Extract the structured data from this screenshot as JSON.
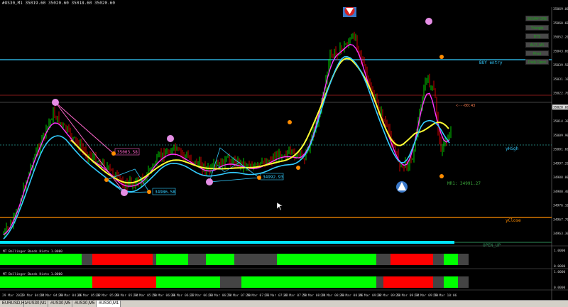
{
  "window": {
    "title": "#US30,M1  35019.60 35020.60 35018.60 35020.60"
  },
  "buttons": [
    "SEMAFORE",
    "Triangle",
    "BTS",
    "AUT_M1",
    "Pivot",
    "Daily Open"
  ],
  "labels": {
    "buy_entry": "BUY entry",
    "yhigh": "yHigh",
    "yclose": "yClose",
    "open_up": "OPEN_UP",
    "timer": "<---00:43",
    "mr": "MR1: 34991.27",
    "level_a": "35003.58",
    "level_b": "34986.58",
    "level_c": "34992.93"
  },
  "price_axis": [
    "35069.00",
    "35060.60",
    "35052.20",
    "35043.80",
    "35039.50",
    "35031.10",
    "35022.70",
    "35020.60",
    "35014.30",
    "35009.90",
    "35001.60",
    "34997.20",
    "34988.80",
    "34980.40",
    "34976.10",
    "34967.70",
    "34963.30"
  ],
  "price_highlight": "35020.60",
  "time_axis": [
    "29 Mar 2022",
    "29 Mar 04:14",
    "29 Mar 04:30",
    "29 Mar 04:46",
    "29 Mar 05:02",
    "29 Mar 05:18",
    "29 Mar 05:34",
    "29 Mar 05:50",
    "29 Mar 06:06",
    "29 Mar 06:22",
    "29 Mar 06:38",
    "29 Mar 06:54",
    "29 Mar 07:10",
    "29 Mar 07:26",
    "29 Mar 07:42",
    "29 Mar 07:58",
    "29 Mar 08:14",
    "29 Mar 08:30",
    "29 Mar 08:46",
    "29 Mar 09:02",
    "29 Mar 09:18",
    "29 Mar 09:34",
    "29 Mar 09:50",
    "29 Mar 10:06"
  ],
  "subwindows": [
    {
      "title": "MT Bollinger Bands Histo 1.0000",
      "axis": [
        "1.0000",
        "0.0000"
      ]
    },
    {
      "title": "MT Bollinger Bands Histo 1.0000",
      "axis": [
        "1.0000",
        "0.0000"
      ]
    }
  ],
  "tabs": [
    "EURUSD,H1",
    "#US30,M1",
    "#US30,M5",
    "#US30,M5",
    "#US30,M1"
  ],
  "active_tab": 4,
  "colors": {
    "up": "#00ff00",
    "down": "#ff0000",
    "ma_fast": "#ff33ff",
    "ma_mid": "#ffff33",
    "ma_slow": "#33ccff",
    "buy_line": "#33ccff",
    "yclose_line": "#ff8c00",
    "open_up": "#00ffff"
  }
}
